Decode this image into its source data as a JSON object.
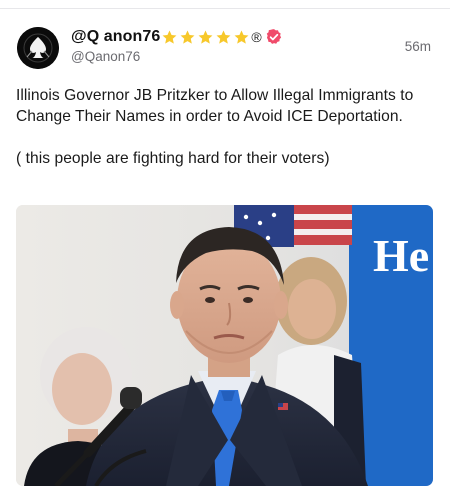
{
  "post": {
    "display_name": "@Q anon76",
    "stars_count": 5,
    "registered_mark": "®",
    "handle": "@Qanon76",
    "time": "56m",
    "text_line_1": "Illinois Governor JB Pritzker to Allow Illegal Immigrants to Change Their Names in order to Avoid ICE Deportation.",
    "text_line_2": "( this people are fighting hard for their voters)",
    "icons": {
      "avatar": "spade-emblem-icon",
      "star": "star-icon",
      "verified": "verified-badge-icon"
    },
    "colors": {
      "star": "#f7c82b",
      "verified": "#f04b6a",
      "avatar_bg": "#0b0b0b"
    }
  },
  "photo": {
    "banner_text": "He"
  }
}
